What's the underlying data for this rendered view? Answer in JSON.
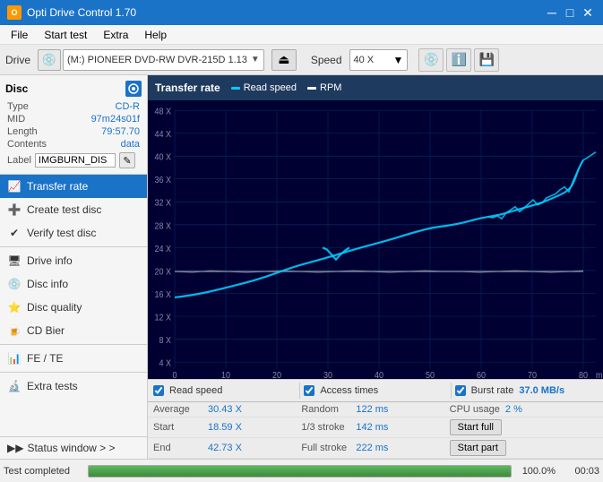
{
  "titleBar": {
    "title": "Opti Drive Control 1.70",
    "minimize": "─",
    "maximize": "□",
    "close": "✕"
  },
  "menuBar": {
    "items": [
      "File",
      "Start test",
      "Extra",
      "Help"
    ]
  },
  "driveBar": {
    "driveLabel": "Drive",
    "driveValue": "(M:)  PIONEER DVD-RW  DVR-215D 1.13",
    "speedLabel": "Speed",
    "speedValue": "40 X"
  },
  "disc": {
    "header": "Disc",
    "typeLabel": "Type",
    "typeValue": "CD-R",
    "midLabel": "MID",
    "midValue": "97m24s01f",
    "lengthLabel": "Length",
    "lengthValue": "79:57.70",
    "contentsLabel": "Contents",
    "contentsValue": "data",
    "labelLabel": "Label",
    "labelValue": "IMGBURN_DIS"
  },
  "nav": {
    "items": [
      {
        "id": "transfer-rate",
        "label": "Transfer rate",
        "active": true
      },
      {
        "id": "create-test-disc",
        "label": "Create test disc",
        "active": false
      },
      {
        "id": "verify-test-disc",
        "label": "Verify test disc",
        "active": false
      },
      {
        "id": "drive-info",
        "label": "Drive info",
        "active": false
      },
      {
        "id": "disc-info",
        "label": "Disc info",
        "active": false
      },
      {
        "id": "disc-quality",
        "label": "Disc quality",
        "active": false
      },
      {
        "id": "cd-bier",
        "label": "CD Bier",
        "active": false
      },
      {
        "id": "fe-te",
        "label": "FE / TE",
        "active": false
      },
      {
        "id": "extra-tests",
        "label": "Extra tests",
        "active": false
      }
    ],
    "statusWindow": "Status window > >"
  },
  "chart": {
    "title": "Transfer rate",
    "legend": [
      {
        "label": "Read speed",
        "color": "#00ccff"
      },
      {
        "label": "RPM",
        "color": "#ffffff"
      }
    ],
    "yAxis": [
      "48 X",
      "44 X",
      "40 X",
      "36 X",
      "32 X",
      "28 X",
      "24 X",
      "20 X",
      "16 X",
      "12 X",
      "8 X",
      "4 X"
    ],
    "xAxis": [
      "0",
      "10",
      "20",
      "30",
      "40",
      "50",
      "60",
      "70",
      "80"
    ],
    "xUnit": "min"
  },
  "checkboxRow": {
    "readSpeed": "Read speed",
    "accessTimes": "Access times",
    "burstRate": "Burst rate",
    "burstRateValue": "37.0 MB/s"
  },
  "stats": {
    "rows": [
      {
        "col1Label": "Average",
        "col1Value": "30.43 X",
        "col2Label": "Random",
        "col2Value": "122 ms",
        "col3Label": "CPU usage",
        "col3Value": "2 %",
        "btn": null
      },
      {
        "col1Label": "Start",
        "col1Value": "18.59 X",
        "col2Label": "1/3 stroke",
        "col2Value": "142 ms",
        "col3Label": null,
        "col3Value": null,
        "btn": "Start full"
      },
      {
        "col1Label": "End",
        "col1Value": "42.73 X",
        "col2Label": "Full stroke",
        "col2Value": "222 ms",
        "col3Label": null,
        "col3Value": null,
        "btn": "Start part"
      }
    ]
  },
  "statusBar": {
    "text": "Test completed",
    "progress": 100,
    "progressText": "100.0%",
    "time": "00:03"
  }
}
